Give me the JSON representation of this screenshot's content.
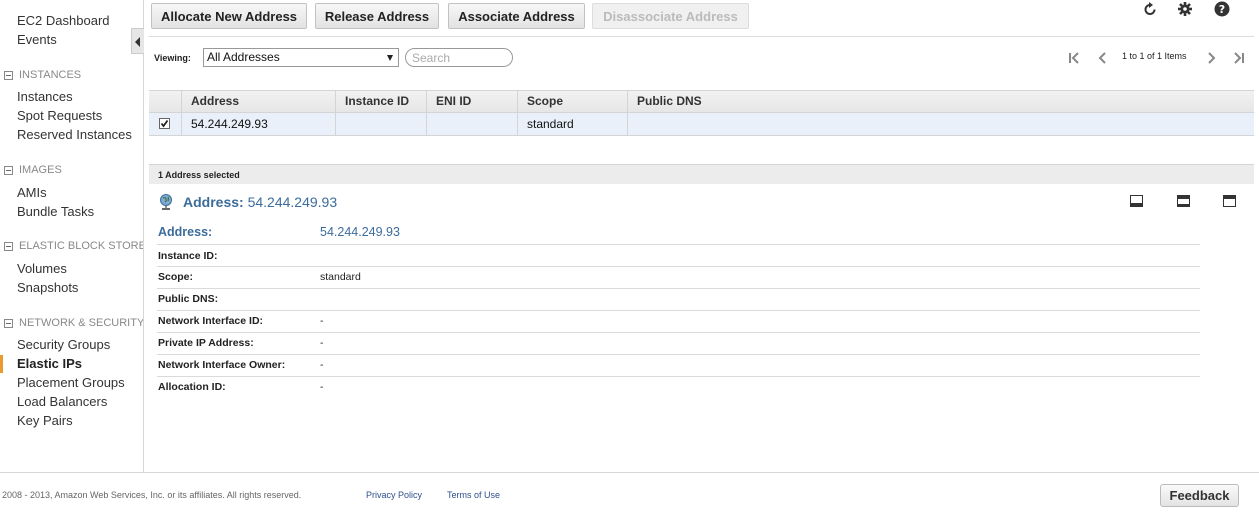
{
  "sidebar": {
    "top_items": [
      {
        "label": "EC2 Dashboard"
      },
      {
        "label": "Events"
      }
    ],
    "sections": [
      {
        "title": "INSTANCES",
        "items": [
          "Instances",
          "Spot Requests",
          "Reserved Instances"
        ]
      },
      {
        "title": "IMAGES",
        "items": [
          "AMIs",
          "Bundle Tasks"
        ]
      },
      {
        "title": "ELASTIC BLOCK STORE",
        "items": [
          "Volumes",
          "Snapshots"
        ]
      },
      {
        "title": "NETWORK & SECURITY",
        "items": [
          "Security Groups",
          "Elastic IPs",
          "Placement Groups",
          "Load Balancers",
          "Key Pairs"
        ]
      }
    ],
    "active_item": "Elastic IPs"
  },
  "toolbar": {
    "allocate_label": "Allocate New Address",
    "release_label": "Release Address",
    "associate_label": "Associate Address",
    "disassociate_label": "Disassociate Address",
    "icons": [
      "refresh-icon",
      "gear-icon",
      "help-icon"
    ]
  },
  "filter": {
    "viewing_label": "Viewing:",
    "selected_option": "All Addresses",
    "search_placeholder": "Search",
    "page_info": "1 to 1 of 1 Items"
  },
  "table": {
    "columns": [
      "Address",
      "Instance ID",
      "ENI ID",
      "Scope",
      "Public DNS"
    ],
    "rows": [
      {
        "checked": true,
        "address": "54.244.249.93",
        "instance_id": "",
        "eni_id": "",
        "scope": "standard",
        "public_dns": ""
      }
    ]
  },
  "details": {
    "selected_count": "1 Address selected",
    "title_label": "Address:",
    "title_value": "54.244.249.93",
    "fields": [
      {
        "label": "Address:",
        "value": "54.244.249.93"
      },
      {
        "label": "Instance ID:",
        "value": ""
      },
      {
        "label": "Scope:",
        "value": "standard"
      },
      {
        "label": "Public DNS:",
        "value": ""
      },
      {
        "label": "Network Interface ID:",
        "value": "-"
      },
      {
        "label": "Private IP Address:",
        "value": "-"
      },
      {
        "label": "Network Interface Owner:",
        "value": "-"
      },
      {
        "label": "Allocation ID:",
        "value": "-"
      }
    ]
  },
  "footer": {
    "copyright": "2008 - 2013, Amazon Web Services, Inc. or its affiliates. All rights reserved.",
    "privacy_label": "Privacy Policy",
    "terms_label": "Terms of Use",
    "feedback_label": "Feedback"
  },
  "colors": {
    "accent": "#e99b31",
    "link": "#2f4f8f",
    "detail_title": "#3c6c9c",
    "selected_row": "#e9f0fa"
  }
}
